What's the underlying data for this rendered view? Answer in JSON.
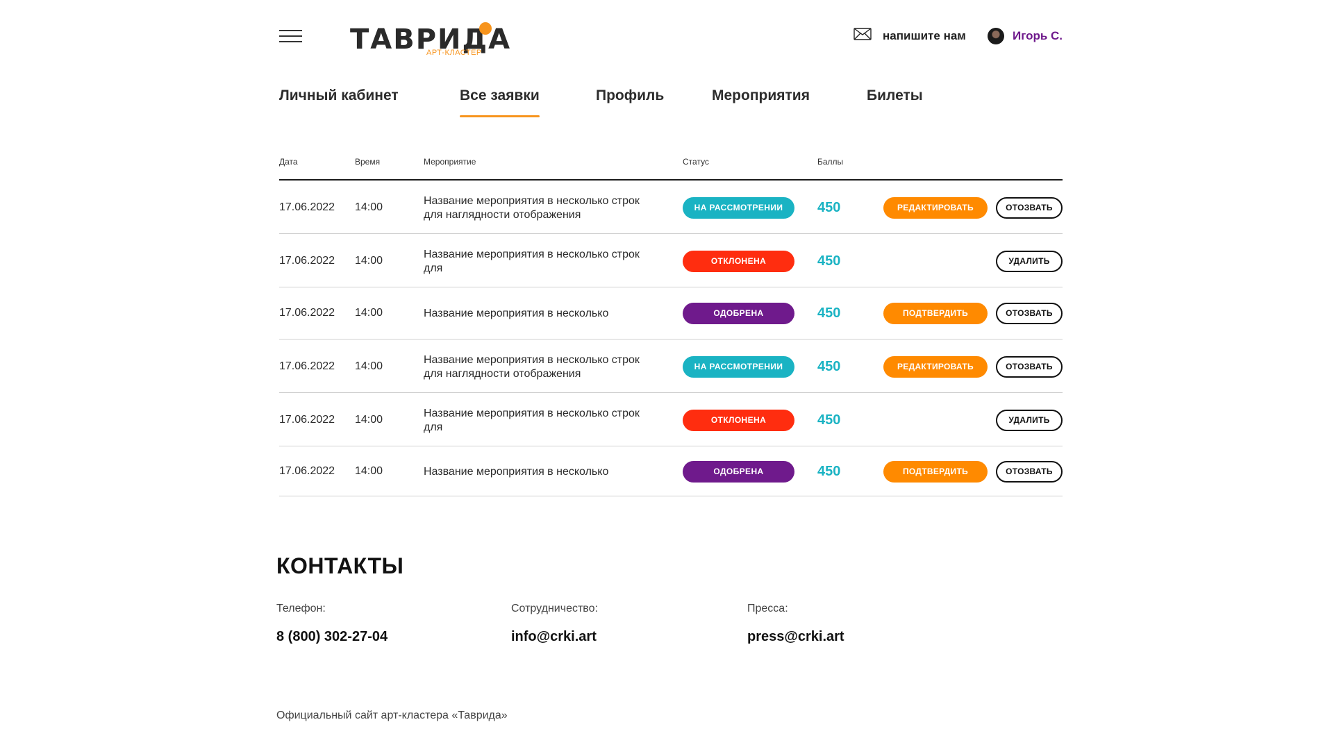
{
  "header": {
    "logo_text": "ТАВРИДА",
    "logo_sub": "АРТ-КЛАСТЕР",
    "mail_label": "напишите нам",
    "user_name": "Игорь С."
  },
  "tabs": [
    {
      "label": "Личный кабинет",
      "active": false
    },
    {
      "label": "Все заявки",
      "active": true
    },
    {
      "label": "Профиль",
      "active": false
    },
    {
      "label": "Мероприятия",
      "active": false
    },
    {
      "label": "Билеты",
      "active": false
    }
  ],
  "table": {
    "headers": {
      "date": "Дата",
      "time": "Время",
      "event": "Мероприятие",
      "status": "Статус",
      "points": "Баллы"
    },
    "rows": [
      {
        "date": "17.06.2022",
        "time": "14:00",
        "event": "Название мероприятия в несколько строк для наглядности отображения",
        "status": "НА РАССМОТРЕНИИ",
        "points": "450",
        "action1": "РЕДАКТИРОВАТЬ",
        "action2": "ОТОЗВАТЬ"
      },
      {
        "date": "17.06.2022",
        "time": "14:00",
        "event": "Название мероприятия в несколько строк для",
        "status": "ОТКЛОНЕНА",
        "points": "450",
        "action1": "",
        "action2": "УДАЛИТЬ"
      },
      {
        "date": "17.06.2022",
        "time": "14:00",
        "event": "Название мероприятия в несколько",
        "status": "ОДОБРЕНА",
        "points": "450",
        "action1": "ПОДТВЕРДИТЬ",
        "action2": "ОТОЗВАТЬ"
      },
      {
        "date": "17.06.2022",
        "time": "14:00",
        "event": "Название мероприятия в несколько строк для наглядности отображения",
        "status": "НА РАССМОТРЕНИИ",
        "points": "450",
        "action1": "РЕДАКТИРОВАТЬ",
        "action2": "ОТОЗВАТЬ"
      },
      {
        "date": "17.06.2022",
        "time": "14:00",
        "event": "Название мероприятия в несколько строк для",
        "status": "ОТКЛОНЕНА",
        "points": "450",
        "action1": "",
        "action2": "УДАЛИТЬ"
      },
      {
        "date": "17.06.2022",
        "time": "14:00",
        "event": "Название мероприятия в несколько",
        "status": "ОДОБРЕНА",
        "points": "450",
        "action1": "ПОДТВЕРДИТЬ",
        "action2": "ОТОЗВАТЬ"
      }
    ]
  },
  "status_colors": {
    "review": "#1ab3c3",
    "rejected": "#ff2d0f",
    "approved": "#6f1a8c",
    "accent": "#ff8a00"
  },
  "contacts": {
    "title": "КОНТАКТЫ",
    "phone_label": "Телефон:",
    "phone": "8 (800) 302-27-04",
    "coop_label": "Сотрудничество:",
    "coop_email": "info@crki.art",
    "press_label": "Пресса:",
    "press_email": "press@crki.art"
  },
  "footer": {
    "note": "Официальный сайт арт-кластера «Таврида»"
  }
}
